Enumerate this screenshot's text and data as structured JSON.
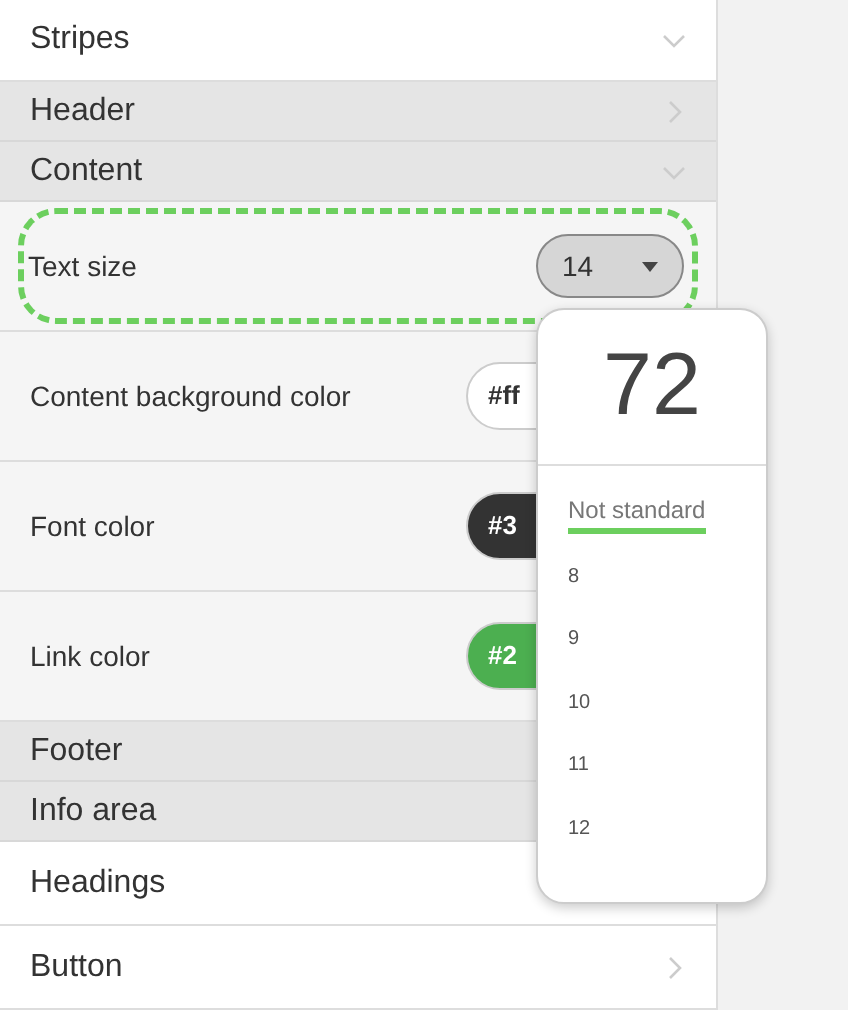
{
  "rows": [
    {
      "kind": "item",
      "label": "Stripes",
      "expanded": true
    },
    {
      "kind": "group",
      "label": "Header",
      "expanded": false
    },
    {
      "kind": "group",
      "label": "Content",
      "expanded": true
    },
    {
      "kind": "select",
      "label": "Text size",
      "value": "14",
      "highlighted": true
    },
    {
      "kind": "color",
      "label": "Content background color",
      "value": "#ff",
      "color": "#ffffff"
    },
    {
      "kind": "color",
      "label": "Font color",
      "value": "#3",
      "color": "#333333"
    },
    {
      "kind": "color",
      "label": "Link color",
      "value": "#2",
      "color": "#4caf50"
    },
    {
      "kind": "group",
      "label": "Footer"
    },
    {
      "kind": "group",
      "label": "Info area"
    },
    {
      "kind": "item",
      "label": "Headings"
    },
    {
      "kind": "item",
      "label": "Button",
      "expanded": false
    }
  ],
  "dropdown": {
    "preview": "72",
    "options": [
      {
        "label": "Not standard",
        "kind": "note",
        "highlighted": true
      },
      {
        "label": "8",
        "kind": "size",
        "highlighted": false
      },
      {
        "label": "9",
        "kind": "size",
        "highlighted": false
      },
      {
        "label": "10",
        "kind": "size",
        "highlighted": false
      },
      {
        "label": "11",
        "kind": "size",
        "highlighted": false
      },
      {
        "label": "12",
        "kind": "size",
        "highlighted": false
      }
    ]
  }
}
